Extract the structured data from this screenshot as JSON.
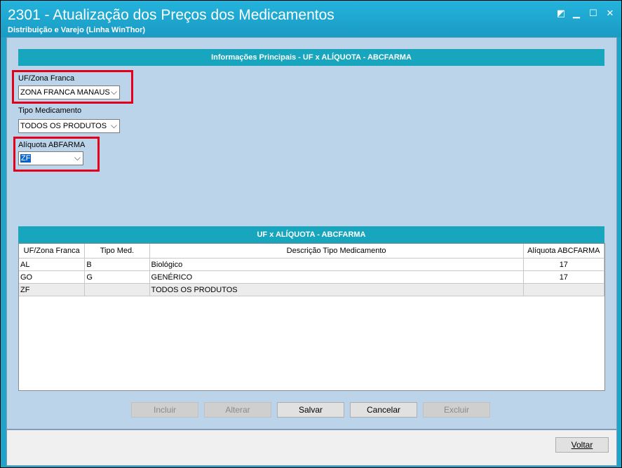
{
  "window": {
    "title": "2301 - Atualização dos Preços dos Medicamentos",
    "subtitle": "Distribuição e Varejo (Linha WinThor)"
  },
  "main_section": {
    "header": "Informações Principais - UF x ALÍQUOTA - ABCFARMA",
    "uf_label": "UF/Zona Franca",
    "uf_value": "ZONA FRANCA MANAUS",
    "tipo_label": "Tipo Medicamento",
    "tipo_value": "TODOS OS PRODUTOS",
    "aliquota_label": "Alíquota ABFARMA",
    "aliquota_value": "ZF"
  },
  "grid_section": {
    "header": "UF x ALÍQUOTA - ABCFARMA",
    "columns": [
      "UF/Zona Franca",
      "Tipo Med.",
      "Descrição Tipo Medicamento",
      "Alíquota ABCFARMA"
    ],
    "rows": [
      [
        "AL",
        "B",
        "Biológico",
        "17"
      ],
      [
        "GO",
        "G",
        "GENÉRICO",
        "17"
      ],
      [
        "ZF",
        "",
        "TODOS OS PRODUTOS",
        ""
      ]
    ]
  },
  "buttons": {
    "incluir": "Incluir",
    "alterar": "Alterar",
    "salvar": "Salvar",
    "cancelar": "Cancelar",
    "excluir": "Excluir",
    "voltar": "Voltar"
  },
  "colors": {
    "title_bar": "#1fa3c9",
    "section_header": "#17a6be",
    "panel": "#bcd4ea",
    "highlight": "#e3001b"
  }
}
